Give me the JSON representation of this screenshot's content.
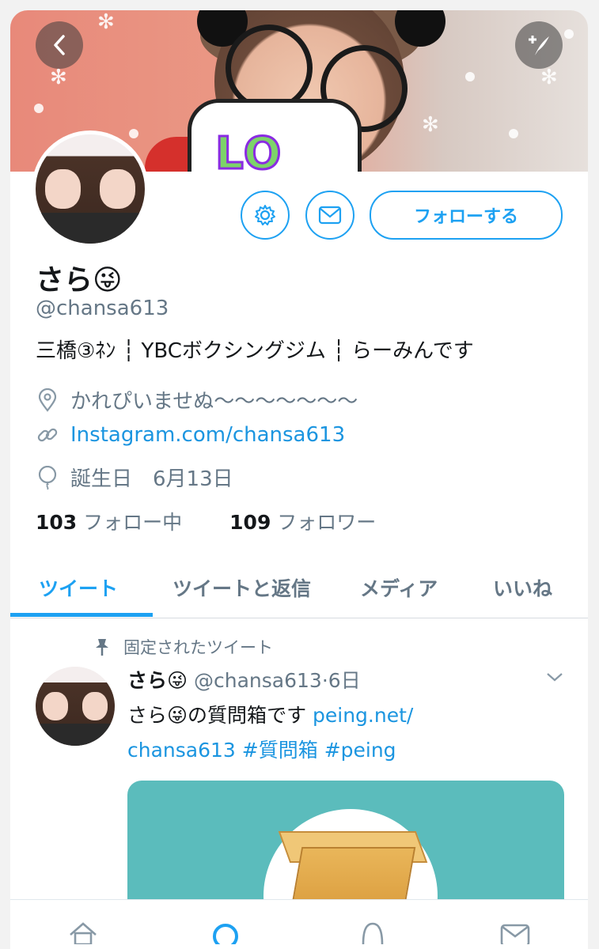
{
  "banner": {
    "bubble_text": "LO"
  },
  "profile": {
    "name": "さら😜",
    "handle": "@chansa613",
    "bio": "三橋③ﾈﾝ ┆ YBCボクシングジム ┆ らーみんです",
    "location": "かれぴいませぬ〜〜〜〜〜〜〜",
    "website": "Instagram.com/chansa613",
    "birthday": "誕生日　6月13日",
    "following_count": "103",
    "following_label": "フォロー中",
    "followers_count": "109",
    "followers_label": "フォロワー"
  },
  "actions": {
    "follow_label": "フォローする"
  },
  "tabs": [
    {
      "label": "ツイート",
      "active": true
    },
    {
      "label": "ツイートと返信",
      "active": false
    },
    {
      "label": "メディア",
      "active": false
    },
    {
      "label": "いいね",
      "active": false
    }
  ],
  "tweet": {
    "pinned_label": "固定されたツイート",
    "author_name": "さら😜",
    "author_handle": "@chansa613",
    "time": "6日",
    "text_prefix": "さら😜の質問箱です ",
    "link1": "peing.net/",
    "link2": "chansa613",
    "hashtag1": "#質問箱",
    "hashtag2": "#peing"
  },
  "colors": {
    "accent": "#1da1f2",
    "secondary_text": "#657786",
    "card_bg": "#5bbcbc"
  },
  "icons": [
    "back-arrow-icon",
    "compose-icon",
    "gear-icon",
    "mail-icon",
    "location-pin-icon",
    "link-icon",
    "balloon-icon",
    "pin-icon",
    "chevron-down-icon",
    "home-icon",
    "search-icon",
    "notifications-icon",
    "messages-icon"
  ]
}
